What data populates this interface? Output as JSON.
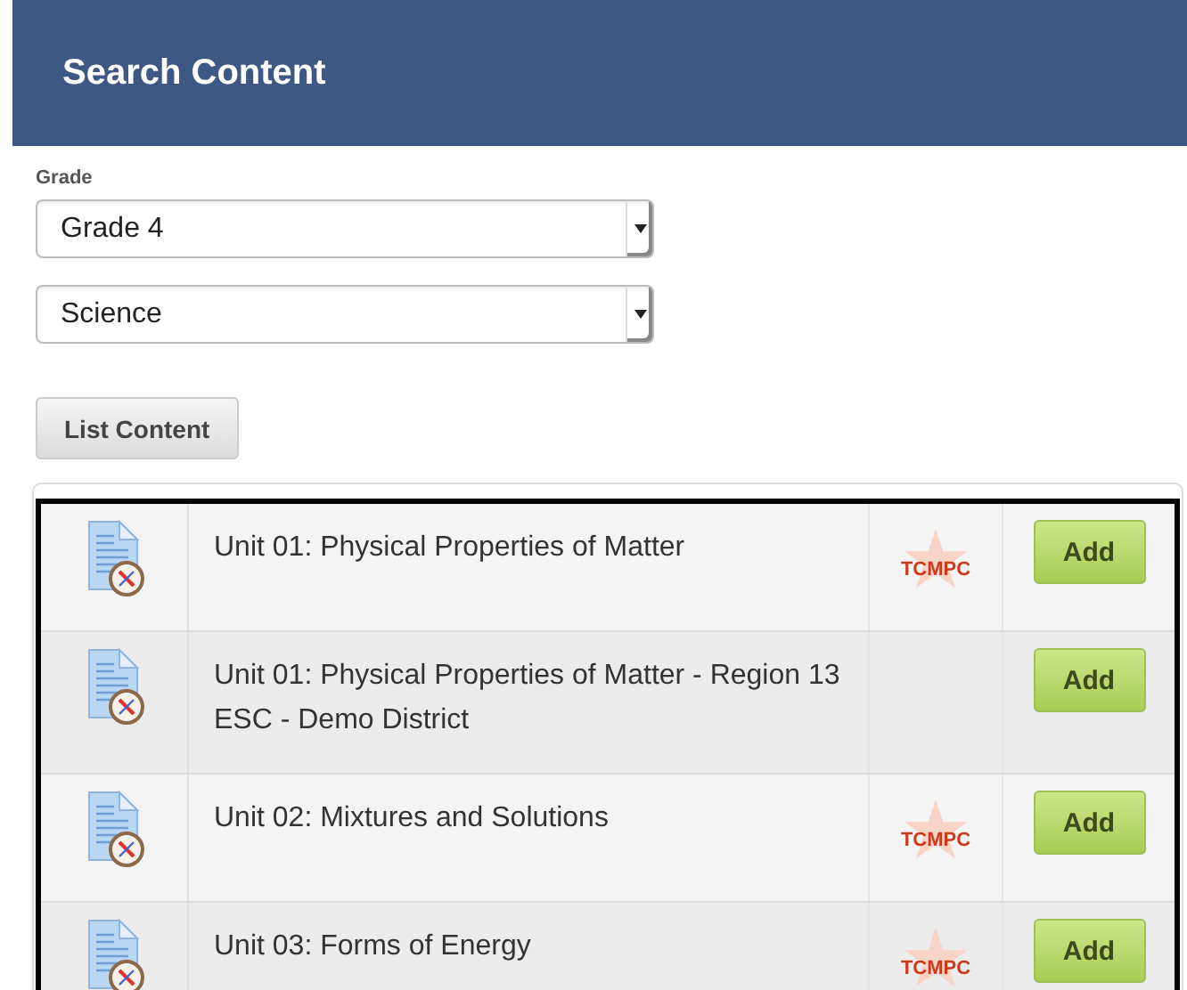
{
  "header": {
    "title": "Search Content"
  },
  "filters": {
    "label": "Grade",
    "selects": [
      {
        "value": "Grade 4"
      },
      {
        "value": "Science"
      }
    ],
    "button": "List Content"
  },
  "results": [
    {
      "title": "Unit 01: Physical Properties of Matter",
      "publisher": "TCMPC",
      "action": "Add"
    },
    {
      "title": "Unit 01: Physical Properties of Matter - Region 13 ESC - Demo District",
      "action": "Add"
    },
    {
      "title": "Unit 02: Mixtures and Solutions",
      "publisher": "TCMPC",
      "action": "Add"
    },
    {
      "title": "Unit 03: Forms of Energy",
      "publisher": "TCMPC",
      "action": "Add"
    }
  ]
}
